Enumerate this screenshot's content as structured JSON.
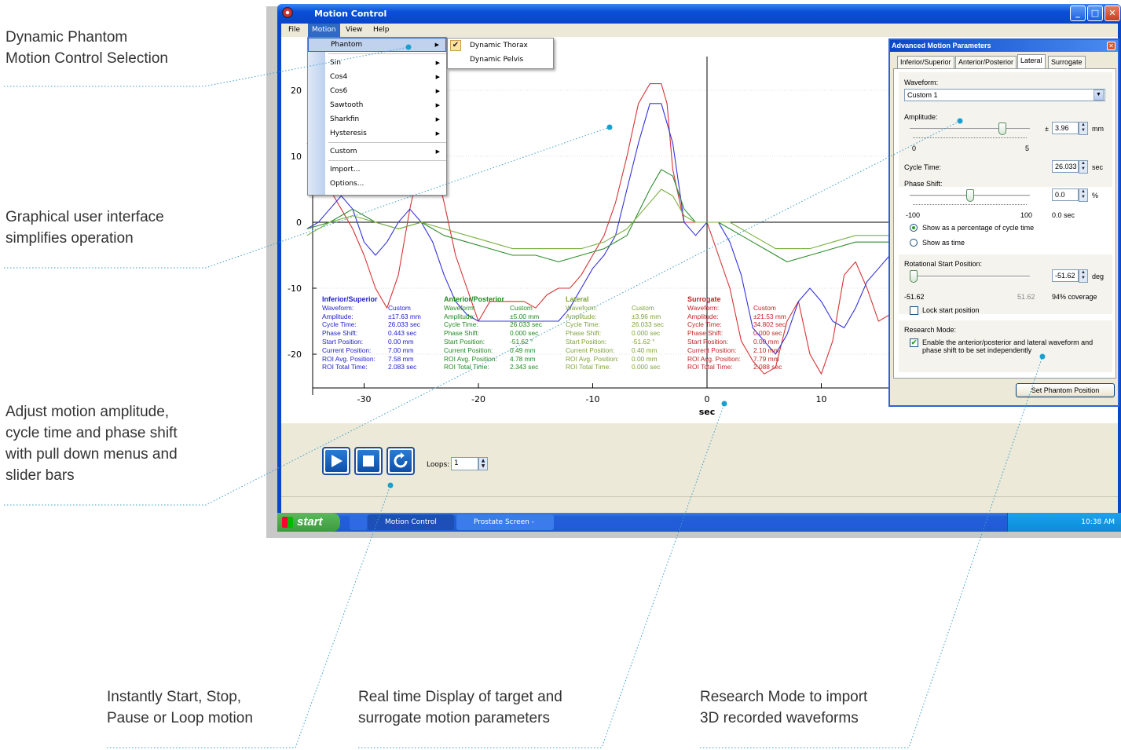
{
  "callouts": [
    {
      "lines": [
        "Dynamic Phantom",
        "Motion Control Selection"
      ]
    },
    {
      "lines": [
        "Graphical user interface",
        "simplifies operation"
      ]
    },
    {
      "lines": [
        "Adjust motion amplitude,",
        "cycle time and phase shift",
        "with pull down menus and",
        "slider bars"
      ]
    },
    {
      "lines": [
        "Instantly Start, Stop,",
        "Pause or Loop motion"
      ]
    },
    {
      "lines": [
        "Real time Display of target and",
        "surrogate motion parameters"
      ]
    },
    {
      "lines": [
        "Research Mode to import",
        "3D recorded waveforms"
      ]
    }
  ],
  "window": {
    "title": "Motion Control",
    "controls": [
      "minimize",
      "maximize",
      "close"
    ]
  },
  "menubar": [
    "File",
    "Motion",
    "View",
    "Help"
  ],
  "motion_menu": {
    "items": [
      "Phantom",
      "Sin",
      "Cos4",
      "Cos6",
      "Sawtooth",
      "Sharkfin",
      "Hysteresis",
      "Custom",
      "Import...",
      "Options..."
    ],
    "highlighted": "Phantom"
  },
  "phantom_submenu": {
    "items": [
      "Dynamic Thorax",
      "Dynamic Pelvis"
    ],
    "checked": "Dynamic Thorax"
  },
  "chart_data": {
    "type": "line",
    "xlabel": "sec",
    "ylabel": "",
    "xlim": [
      -37,
      24
    ],
    "ylim": [
      -25,
      28
    ],
    "xticks": [
      -30,
      -20,
      -10,
      0,
      10
    ],
    "yticks": [
      20,
      10,
      0,
      -10,
      -20
    ],
    "series": [
      {
        "color": "#d63333",
        "x": [
          -35,
          -34,
          -33,
          -32,
          -31,
          -30,
          -29,
          -28,
          -27,
          -26,
          -25,
          -24,
          -23,
          -22,
          -21,
          -20,
          -19,
          -18,
          -17,
          -16,
          -15,
          -14,
          -13,
          -12,
          -11,
          -10,
          -9,
          -8,
          -7,
          -6,
          -5,
          -4,
          -3.5,
          -3,
          -2,
          -1,
          0,
          1,
          2,
          3,
          4,
          5,
          6,
          7,
          8,
          9,
          10,
          11,
          12,
          13,
          14,
          15,
          16,
          17,
          18,
          19,
          20,
          21,
          22,
          23
        ],
        "y": [
          12,
          10,
          5,
          2,
          -1,
          -5,
          -10,
          -13,
          -8,
          2,
          10,
          10,
          3,
          -5,
          -10,
          -15,
          -12,
          -12,
          -12,
          -12,
          -13,
          -11,
          -10,
          -10,
          -8,
          -5,
          -2,
          3,
          10,
          18,
          21,
          21,
          18,
          8,
          0,
          0,
          0,
          -5,
          -10,
          -18,
          -21,
          -23,
          -22,
          -15,
          -12,
          -20,
          -23,
          -18,
          -8,
          -6,
          -10,
          -15,
          -14,
          -7,
          -4,
          -8,
          -15,
          -12,
          -6,
          -10
        ]
      },
      {
        "color": "#3333dd",
        "x": [
          -35,
          -34,
          -33,
          -32,
          -31,
          -30,
          -29,
          -28,
          -27,
          -26,
          -25,
          -24,
          -23,
          -22,
          -21,
          -20,
          -19,
          -18,
          -17,
          -16,
          -15,
          -14,
          -13,
          -12,
          -11,
          -10,
          -9,
          -8,
          -7,
          -6,
          -5,
          -4,
          -3,
          -2,
          -1,
          0,
          1,
          2,
          3,
          4,
          5,
          6,
          7,
          8,
          9,
          10,
          11,
          12,
          13,
          14,
          15,
          16,
          17,
          18,
          19,
          20,
          21,
          22,
          23
        ],
        "y": [
          -1,
          0,
          2,
          4,
          2,
          -3,
          -5,
          -3,
          0,
          2,
          0,
          -3,
          -8,
          -12,
          -14,
          -15,
          -15,
          -15,
          -15,
          -15,
          -15,
          -15,
          -15,
          -13,
          -10,
          -7,
          -5,
          -2,
          5,
          12,
          18,
          18,
          12,
          0,
          -2,
          0,
          0,
          -3,
          -8,
          -16,
          -18,
          -20,
          -17,
          -12,
          -10,
          -12,
          -15,
          -16,
          -13,
          -9,
          -7,
          -5,
          -8,
          -13,
          -15,
          -17,
          -15,
          -12,
          -10
        ]
      },
      {
        "color": "#2e8b2e",
        "x": [
          -35,
          -33,
          -31,
          -29,
          -27,
          -25,
          -23,
          -21,
          -19,
          -17,
          -15,
          -13,
          -11,
          -9,
          -7,
          -5,
          -4,
          -3,
          -2,
          -1,
          0,
          1,
          2,
          3,
          4,
          5,
          6,
          7,
          9,
          11,
          13,
          15,
          17,
          19,
          21,
          23
        ],
        "y": [
          -1,
          0,
          2,
          0,
          -1,
          0,
          -2,
          -3,
          -4,
          -5,
          -5,
          -6,
          -5,
          -4,
          -2,
          5,
          8,
          7,
          2,
          0,
          0,
          0,
          -1,
          -2,
          -3,
          -4,
          -5,
          -6,
          -5,
          -4,
          -3,
          -3,
          -3,
          -3,
          -4,
          -4
        ]
      },
      {
        "color": "#7ab040",
        "x": [
          -35,
          -33,
          -31,
          -29,
          -27,
          -25,
          -23,
          -21,
          -19,
          -17,
          -15,
          -13,
          -11,
          -9,
          -7,
          -5,
          -4,
          -3,
          -2,
          -1,
          0,
          1,
          2,
          3,
          4,
          5,
          6,
          7,
          9,
          11,
          13,
          15,
          17,
          19,
          21,
          23
        ],
        "y": [
          -2,
          0,
          1,
          0,
          -1,
          0,
          -1,
          -2,
          -3,
          -4,
          -4,
          -4,
          -4,
          -3,
          -1,
          3,
          5,
          4,
          1,
          0,
          0,
          0,
          0,
          -1,
          -2,
          -3,
          -4,
          -4,
          -4,
          -3,
          -2,
          -2,
          -2,
          -2,
          -3,
          -3
        ]
      }
    ]
  },
  "params": [
    {
      "title": "Inferior/Superior",
      "color": "#2222cc",
      "labels": [
        "Waveform:",
        "Amplitude:",
        "Cycle Time:",
        "Phase Shift:",
        "Start Position:",
        "Current Position:",
        "ROI Avg. Position:",
        "ROI Total Time:"
      ],
      "values": [
        "Custom",
        "±17.63 mm",
        "26.033 sec",
        "0.443 sec",
        "0.00 mm",
        "7.00 mm",
        "7.58 mm",
        "2.083 sec"
      ]
    },
    {
      "title": "Anterior/Posterior",
      "color": "#1f8a1f",
      "labels": [
        "Waveform:",
        "Amplitude:",
        "Cycle Time:",
        "Phase Shift:",
        "Start Position:",
        "Current Position:",
        "ROI Avg. Position:",
        "ROI Total Time:"
      ],
      "values": [
        "Custom",
        "±5.00 mm",
        "26.033 sec",
        "0.000 sec",
        "-51.62 °",
        "0.49 mm",
        "4.78 mm",
        "2.343 sec"
      ]
    },
    {
      "title": "Lateral",
      "color": "#7ea33a",
      "labels": [
        "Waveform:",
        "Amplitude:",
        "Cycle Time:",
        "Phase Shift:",
        "Start Position:",
        "Current Position:",
        "ROI Avg. Position:",
        "ROI Total Time:"
      ],
      "values": [
        "Custom",
        "±3.96 mm",
        "26.033 sec",
        "0.000 sec",
        "-51.62 °",
        "0.40 mm",
        "0.00 mm",
        "0.000 sec"
      ]
    },
    {
      "title": "Surrogate",
      "color": "#c02626",
      "labels": [
        "Waveform:",
        "Amplitude:",
        "Cycle Time:",
        "Phase Shift:",
        "Start Position:",
        "Current Position:",
        "ROI Avg. Position:",
        "ROI Total Time:"
      ],
      "values": [
        "Custom",
        "±21.53 mm",
        "34.802 sec",
        "0.000 sec",
        "0.00 mm",
        "2.10 mm",
        "7.79 mm",
        "2.088 sec"
      ]
    }
  ],
  "playback": {
    "loops_label": "Loops:",
    "loops_value": "1"
  },
  "advanced": {
    "title": "Advanced Motion Parameters",
    "tabs": [
      "Inferior/Superior",
      "Anterior/Posterior",
      "Lateral",
      "Surrogate"
    ],
    "active_tab": "Lateral",
    "waveform_label": "Waveform:",
    "waveform_value": "Custom 1",
    "amplitude_label": "Amplitude:",
    "amplitude_pm": "±",
    "amplitude_value": "3.96",
    "amplitude_unit": "mm",
    "amplitude_min": "0",
    "amplitude_max": "5",
    "amplitude_fraction": 0.79,
    "cycle_label": "Cycle Time:",
    "cycle_value": "26.033",
    "cycle_unit": "sec",
    "phase_label": "Phase Shift:",
    "phase_value": "0.0",
    "phase_unit": "%",
    "phase_min": "-100",
    "phase_max": "100",
    "phase_time": "0.0 sec",
    "phase_fraction": 0.5,
    "radio_percent": "Show as a percentage of cycle time",
    "radio_time": "Show as time",
    "rot_label": "Rotational Start Position:",
    "rot_value": "-51.62",
    "rot_unit": "deg",
    "rot_min": "-51.62",
    "rot_max": "51.62",
    "rot_coverage": "94% coverage",
    "rot_fraction": 0.0,
    "lock_label": "Lock start position",
    "research_label": "Research Mode:",
    "research_text1": "Enable the anterior/posterior and lateral waveform and",
    "research_text2": "phase shift to be set independently",
    "set_button": "Set Phantom Position"
  },
  "taskbar": {
    "start": "start",
    "tasks": [
      "Motion Control",
      "Prostate Screen - Paint"
    ],
    "clock": "10:38 AM"
  }
}
